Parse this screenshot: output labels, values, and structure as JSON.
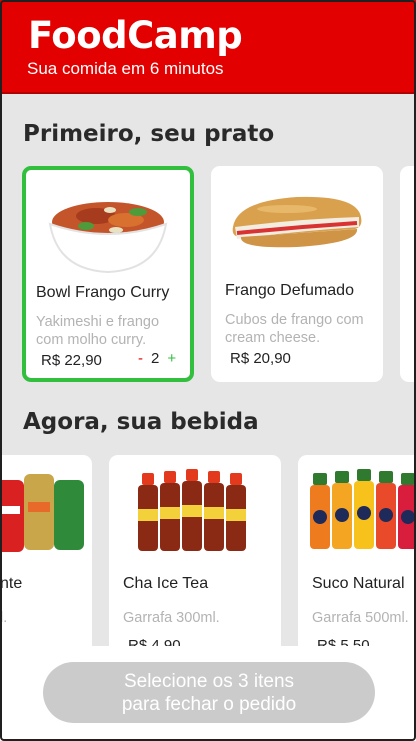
{
  "header": {
    "logo": "FoodCamp",
    "tagline": "Sua comida em 6 minutos"
  },
  "sections": {
    "dishes_title": "Primeiro, seu prato",
    "drinks_title": "Agora, sua bebida"
  },
  "dishes": [
    {
      "name": "Bowl Frango Curry",
      "description": "Yakimeshi e frango com molho curry.",
      "price": "R$ 22,90",
      "selected": true,
      "quantity": "2",
      "minus": "-",
      "plus": "+"
    },
    {
      "name": "Frango Defumado",
      "description": "Cubos de frango com cream cheese.",
      "price": "R$ 20,90",
      "selected": false
    }
  ],
  "drinks": [
    {
      "name": "nte",
      "description": "l.",
      "price": ""
    },
    {
      "name": "Cha Ice Tea",
      "description": "Garrafa 300ml.",
      "price": "R$ 4,90"
    },
    {
      "name": "Suco Natural",
      "description": "Garrafa 500ml.",
      "price": "R$ 5,50"
    }
  ],
  "footer": {
    "order_button": "Selecione os 3 itens\npara fechar o pedido"
  },
  "colors": {
    "brand_red": "#e30000",
    "selected_green": "#32bf3e",
    "disabled_button": "#cbcbcb"
  }
}
